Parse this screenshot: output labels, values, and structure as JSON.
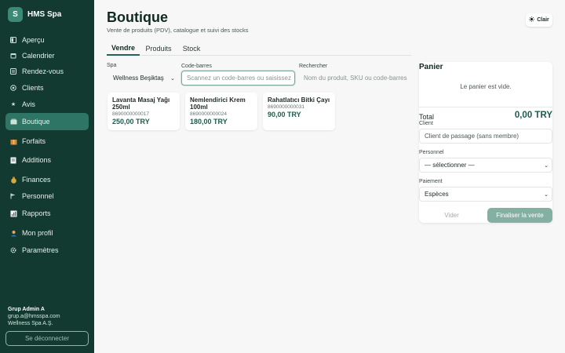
{
  "app": {
    "logo_letter": "S",
    "name": "HMS Spa"
  },
  "sidebar": {
    "items": [
      {
        "label": "Aperçu",
        "icon": "dashboard-icon"
      },
      {
        "label": "Calendrier",
        "icon": "calendar-icon"
      },
      {
        "label": "Rendez-vous",
        "icon": "appointments-icon"
      },
      {
        "label": "Clients",
        "icon": "clients-icon"
      },
      {
        "label": "Avis",
        "icon": "star-icon"
      },
      {
        "label": "Boutique",
        "icon": "shop-icon",
        "active": true
      },
      {
        "label": "Forfaits",
        "icon": "package-icon"
      },
      {
        "label": "Additions",
        "icon": "receipt-icon"
      },
      {
        "label": "Finances",
        "icon": "money-bag-icon"
      },
      {
        "label": "Personnel",
        "icon": "flag-icon"
      },
      {
        "label": "Rapports",
        "icon": "chart-icon"
      },
      {
        "label": "Mon profil",
        "icon": "user-icon"
      },
      {
        "label": "Paramètres",
        "icon": "gear-icon"
      }
    ],
    "user": {
      "name": "Grup Admin A",
      "email": "grup.a@hmsspa.com",
      "org": "Wellness Spa A.Ş."
    },
    "logout_label": "Se déconnecter"
  },
  "header": {
    "title": "Boutique",
    "subtitle": "Vente de produits (PDV), catalogue et suivi des stocks",
    "theme_icon": "sun-icon",
    "theme_label": "Clair"
  },
  "tabs": [
    {
      "label": "Vendre",
      "active": true
    },
    {
      "label": "Produits"
    },
    {
      "label": "Stock"
    }
  ],
  "filters": {
    "spa_label": "Spa",
    "spa_value": "Wellness Beşiktaş",
    "barcode_label": "Code-barres",
    "barcode_placeholder": "Scannez un code-barres ou saisissez",
    "search_label": "Rechercher",
    "search_placeholder": "Nom du produit, SKU ou code-barres"
  },
  "products": [
    {
      "name": "Lavanta Masaj Yağı 250ml",
      "sku": "8690000000017",
      "price": "250,00 TRY"
    },
    {
      "name": "Nemlendirici Krem 100ml",
      "sku": "8690000000024",
      "price": "180,00 TRY"
    },
    {
      "name": "Rahatlatıcı Bitki Çayı",
      "sku": "8690000000031",
      "price": "90,00 TRY"
    }
  ],
  "cart": {
    "title": "Panier",
    "empty_text": "Le panier est vide.",
    "total_label": "Total",
    "total_value": "0,00 TRY",
    "client_label": "Client",
    "client_placeholder": "Client de passage (sans membre)",
    "staff_label": "Personnel",
    "staff_value": "— sélectionner —",
    "payment_label": "Paiement",
    "payment_value": "Espèces",
    "clear_label": "Vider",
    "finish_label": "Finaliser la vente"
  },
  "colors": {
    "sidebar_bg": "#123a30",
    "active_item": "#2f7565",
    "accent": "#1c5c4c",
    "finish_button": "#84b0a4"
  }
}
